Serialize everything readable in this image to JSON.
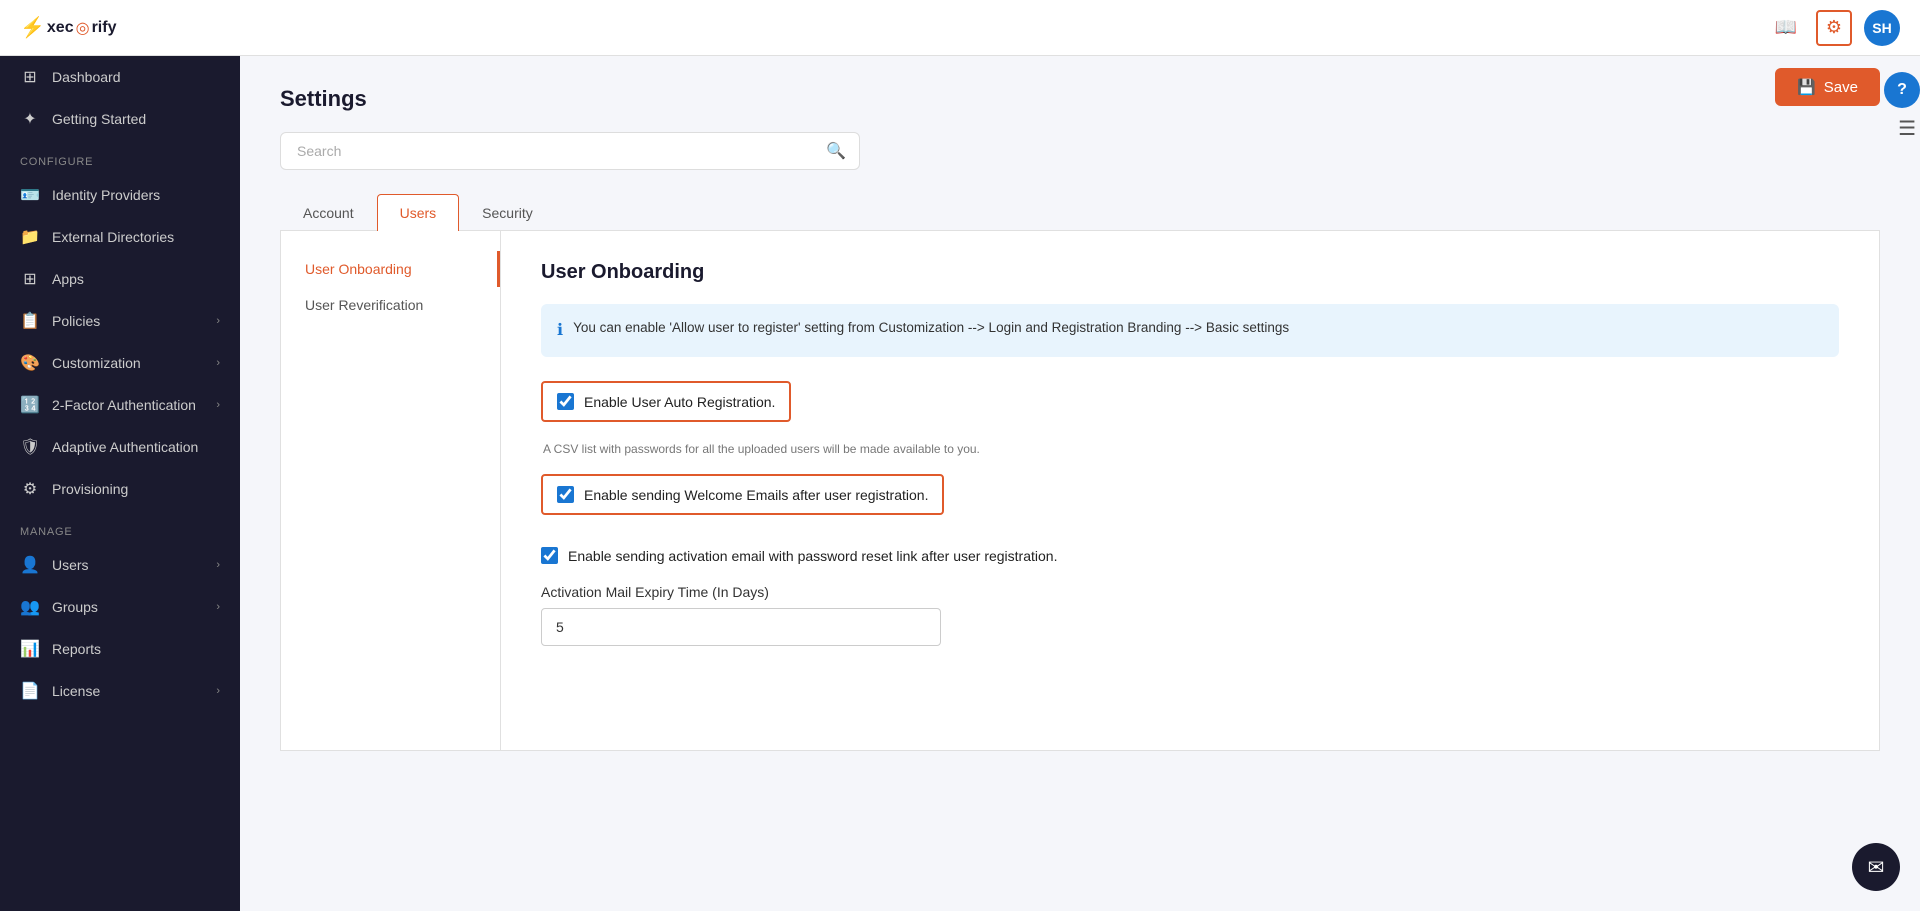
{
  "header": {
    "logo": "xecOrify",
    "logo_part1": "xec",
    "logo_part2": "rify",
    "avatar_initials": "SH",
    "book_icon": "📖",
    "gear_icon": "⚙",
    "help_icon": "?"
  },
  "sidebar": {
    "section_configure": "Configure",
    "section_manage": "Manage",
    "items": [
      {
        "id": "dashboard",
        "label": "Dashboard",
        "icon": "⊞",
        "chevron": false
      },
      {
        "id": "getting-started",
        "label": "Getting Started",
        "icon": "🚀",
        "chevron": false
      },
      {
        "id": "identity-providers",
        "label": "Identity Providers",
        "icon": "🪪",
        "chevron": false
      },
      {
        "id": "external-directories",
        "label": "External Directories",
        "icon": "📁",
        "chevron": false
      },
      {
        "id": "apps",
        "label": "Apps",
        "icon": "⊞",
        "chevron": false
      },
      {
        "id": "policies",
        "label": "Policies",
        "icon": "📋",
        "chevron": true
      },
      {
        "id": "customization",
        "label": "Customization",
        "icon": "🎨",
        "chevron": true
      },
      {
        "id": "2fa",
        "label": "2-Factor Authentication",
        "icon": "🔢",
        "chevron": true
      },
      {
        "id": "adaptive-auth",
        "label": "Adaptive Authentication",
        "icon": "🛡",
        "chevron": false
      },
      {
        "id": "provisioning",
        "label": "Provisioning",
        "icon": "⚙",
        "chevron": false
      },
      {
        "id": "users",
        "label": "Users",
        "icon": "👤",
        "chevron": true
      },
      {
        "id": "groups",
        "label": "Groups",
        "icon": "👥",
        "chevron": true
      },
      {
        "id": "reports",
        "label": "Reports",
        "icon": "📊",
        "chevron": false
      },
      {
        "id": "license",
        "label": "License",
        "icon": "📄",
        "chevron": true
      }
    ]
  },
  "page": {
    "title": "Settings",
    "search_placeholder": "Search"
  },
  "tabs": [
    {
      "id": "account",
      "label": "Account",
      "active": false
    },
    {
      "id": "users",
      "label": "Users",
      "active": true
    },
    {
      "id": "security",
      "label": "Security",
      "active": false
    }
  ],
  "settings_nav": [
    {
      "id": "user-onboarding",
      "label": "User Onboarding",
      "active": true
    },
    {
      "id": "user-reverification",
      "label": "User Reverification",
      "active": false
    }
  ],
  "panel": {
    "title": "User Onboarding",
    "info_text": "You can enable 'Allow user to register' setting from Customization --> Login and Registration Branding --> Basic settings",
    "checkboxes": [
      {
        "id": "auto-registration",
        "label": "Enable User Auto Registration.",
        "checked": true,
        "outlined": true,
        "hint": "A CSV list with passwords for all the uploaded users will be made available to you."
      },
      {
        "id": "welcome-emails",
        "label": "Enable sending Welcome Emails after user registration.",
        "checked": true,
        "outlined": true,
        "hint": ""
      },
      {
        "id": "activation-email",
        "label": "Enable sending activation email with password reset link after user registration.",
        "checked": true,
        "outlined": false,
        "hint": ""
      }
    ],
    "expiry_field": {
      "label": "Activation Mail Expiry Time (In Days)",
      "value": "5"
    },
    "save_label": "Save"
  }
}
